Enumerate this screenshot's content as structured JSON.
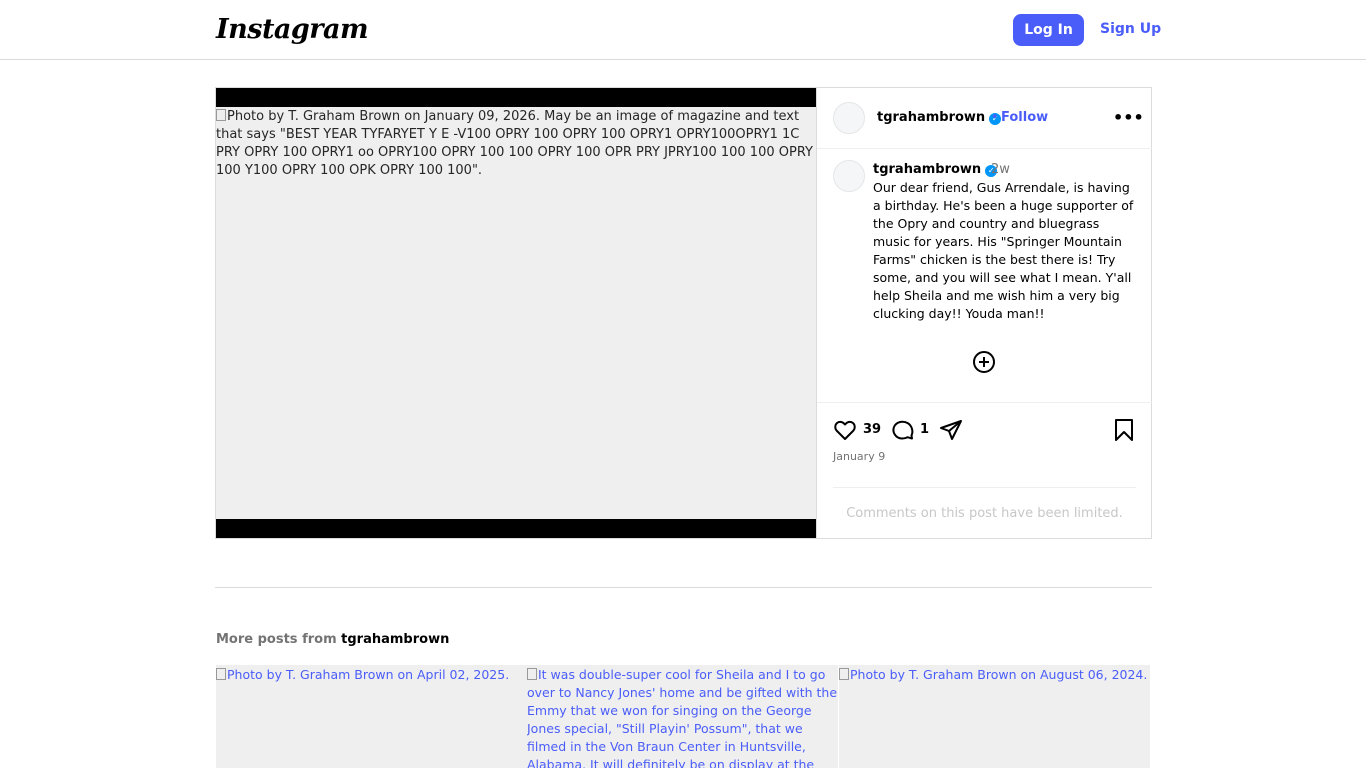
{
  "header": {
    "logo_text": "Instagram",
    "login_label": "Log In",
    "signup_label": "Sign Up"
  },
  "post": {
    "image_alt": "Photo by T. Graham Brown on January 09, 2026. May be an image of magazine and text that says \"BEST YEAR TYFARYET Y E -V100 OPRY 100 OPRY 100 OPRY1 OPRY100OPRY1 1C PRY OPRY 100 OPRY1 oo OPRY100 OPRY 100 100 OPRY 100 OPR PRY JPRY100 100 100 OPRY 100 Y100 OPRY 100 OPK OPRY 100 100\".",
    "username": "tgrahambrown",
    "follow_separator": "•",
    "follow_label": "Follow",
    "more_icon": "more-horizontal-icon",
    "caption_time": "2w",
    "caption_text": "Our dear friend, Gus Arrendale, is having a birthday. He's been a huge supporter of the Opry and country and bluegrass music for years. His \"Springer Mountain Farms\" chicken is the best there is! Try some, and you will see what I mean. Y'all help Sheila and me wish him a very big clucking day!! Youda man!!",
    "like_count": "39",
    "comment_count": "1",
    "date": "January 9",
    "comments_limited": "Comments on this post have been limited."
  },
  "more_posts": {
    "prefix": "More posts from",
    "username": "tgrahambrown",
    "items": [
      {
        "alt": "Photo by T. Graham Brown on April 02, 2025."
      },
      {
        "alt": "It was double-super cool for Sheila and I to go over to Nancy Jones' home and be gifted with the Emmy that we won for singing on the George Jones special, \"Still Playin' Possum\", that we filmed in the Von Braun Center in Huntsville, Alabama. It will definitely be on display at the Brown"
      },
      {
        "alt": "Photo by T. Graham Brown on August 06, 2024."
      }
    ]
  },
  "colors": {
    "accent": "#4a5df9",
    "verified": "#0095f6",
    "muted": "#737373",
    "border": "#dbdbdb"
  }
}
